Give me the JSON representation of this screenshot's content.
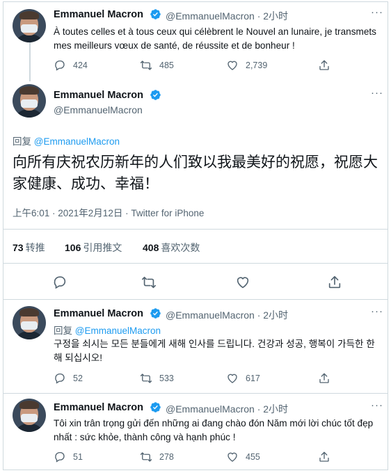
{
  "tweet1": {
    "name": "Emmanuel Macron",
    "handle_time": "@EmmanuelMacron · 2小时",
    "text": "À toutes celles et à tous ceux qui célèbrent le Nouvel an lunaire, je transmets mes meilleurs vœux de santé, de réussite et de bonheur !",
    "replies": "424",
    "retweets": "485",
    "likes": "2,739"
  },
  "tweet2": {
    "name": "Emmanuel Macron",
    "handle": "@EmmanuelMacron",
    "reply_prefix": "回复",
    "reply_target": "@EmmanuelMacron",
    "text": "向所有庆祝农历新年的人们致以我最美好的祝愿，祝愿大家健康、成功、幸福！",
    "timestamp": "上午6:01 · 2021年2月12日 · Twitter for iPhone",
    "stats": {
      "retweets_count": "73",
      "retweets_label": "转推",
      "quotes_count": "106",
      "quotes_label": "引用推文",
      "likes_count": "408",
      "likes_label": "喜欢次数"
    }
  },
  "tweet3": {
    "name": "Emmanuel Macron",
    "handle_time": "@EmmanuelMacron · 2小时",
    "reply_prefix": "回复",
    "reply_target": "@EmmanuelMacron",
    "text": "구정을 쇠시는 모든 분들에게 새해 인사를 드립니다. 건강과 성공, 행복이 가득한 한 해 되십시오!",
    "replies": "52",
    "retweets": "533",
    "likes": "617"
  },
  "tweet4": {
    "name": "Emmanuel Macron",
    "handle_time": "@EmmanuelMacron · 2小时",
    "text": "Tôi xin trân trọng gửi đến những ai đang chào đón Năm mới lời chúc tốt đẹp nhất : sức khỏe, thành công và hạnh phúc !",
    "replies": "51",
    "retweets": "278",
    "likes": "455"
  },
  "colors": {
    "accent": "#1d9bf0",
    "muted": "#536471",
    "text": "#0f1419",
    "border": "#cfd9de"
  }
}
